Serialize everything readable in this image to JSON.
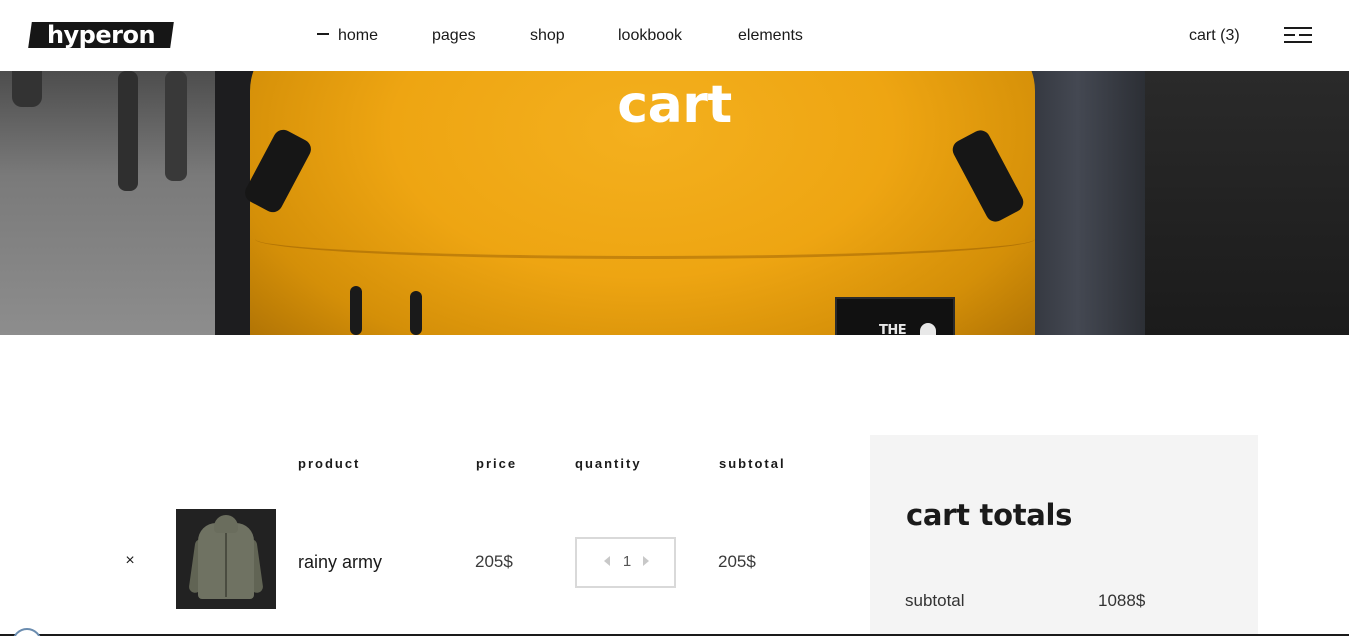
{
  "brand": {
    "logo_text": "hyperon"
  },
  "nav": {
    "items": [
      {
        "label": "home",
        "active": true
      },
      {
        "label": "pages"
      },
      {
        "label": "shop"
      },
      {
        "label": "lookbook"
      },
      {
        "label": "elements"
      }
    ],
    "cart_label": "cart (3)",
    "menu_icon": "hamburger-menu-icon"
  },
  "hero": {
    "title": "cart",
    "patch_text": "THE"
  },
  "cart_table": {
    "headers": {
      "product": "product",
      "price": "price",
      "quantity": "quantity",
      "subtotal": "subtotal"
    },
    "rows": [
      {
        "remove_symbol": "×",
        "product_name": "rainy army",
        "price": "205$",
        "quantity": "1",
        "subtotal": "205$"
      }
    ]
  },
  "cart_totals": {
    "title": "cart totals",
    "subtotal_label": "subtotal",
    "subtotal_value": "1088$"
  },
  "colors": {
    "accent_yellow": "#eea512",
    "text_dark": "#1a1a1a",
    "panel_bg": "#f4f4f4"
  }
}
